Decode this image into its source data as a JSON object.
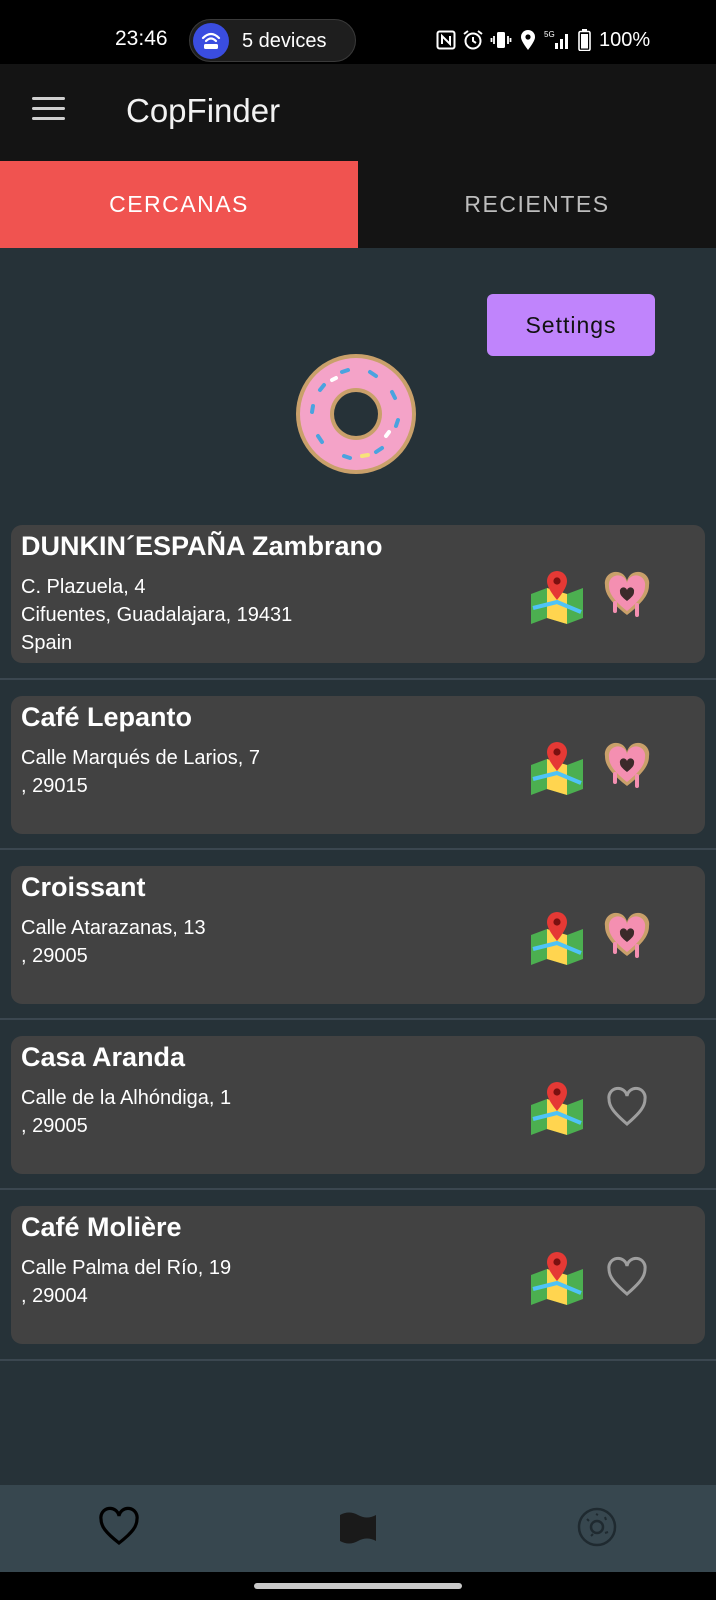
{
  "status_bar": {
    "time": "23:46",
    "devices_label": "5 devices",
    "battery": "100%",
    "icons": [
      "nfc-icon",
      "alarm-icon",
      "vibrate-icon",
      "location-icon",
      "5g-signal-icon",
      "battery-icon"
    ]
  },
  "app_bar": {
    "title": "CopFinder",
    "menu_icon": "hamburger-menu-icon"
  },
  "tabs": [
    {
      "label": "CERCANAS",
      "active": true
    },
    {
      "label": "RECIENTES",
      "active": false
    }
  ],
  "settings_label": "Settings",
  "places": [
    {
      "name": "DUNKIN´ESPAÑA Zambrano",
      "address": [
        "C. Plazuela, 4",
        "Cifuentes, Guadalajara, 19431",
        "Spain"
      ],
      "favorite": true
    },
    {
      "name": "Café Lepanto",
      "address": [
        "Calle Marqués de Larios, 7",
        ", 29015"
      ],
      "favorite": true
    },
    {
      "name": "Croissant",
      "address": [
        "Calle Atarazanas, 13",
        ", 29005"
      ],
      "favorite": true
    },
    {
      "name": "Casa Aranda",
      "address": [
        "Calle de la Alhóndiga, 1",
        ", 29005"
      ],
      "favorite": false
    },
    {
      "name": "Café Molière",
      "address": [
        "Calle Palma del Río, 19",
        ", 29004"
      ],
      "favorite": false
    }
  ],
  "bottom_nav": [
    {
      "icon": "heart-icon"
    },
    {
      "icon": "flag-icon"
    },
    {
      "icon": "donut-icon"
    }
  ],
  "colors": {
    "accent": "#f05350",
    "settings_button": "#c084fc",
    "background": "#263238",
    "card": "#424242",
    "bottom_nav": "#37474f"
  }
}
